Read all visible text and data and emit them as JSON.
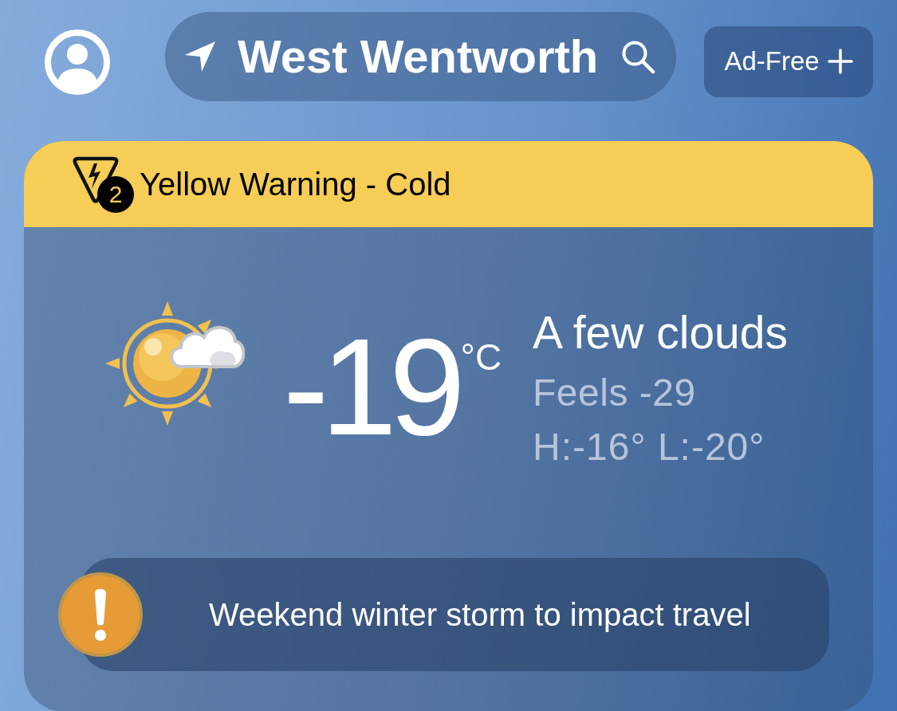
{
  "header": {
    "location": "West Wentworth",
    "ad_free_label": "Ad-Free"
  },
  "warning_banner": {
    "title": "Yellow Warning - Cold",
    "count": "2"
  },
  "current": {
    "temperature": "-19",
    "unit": "°C",
    "condition": "A few clouds",
    "feels_like": "Feels -29",
    "high_low": "H:-16° L:-20°"
  },
  "news": {
    "headline": "Weekend winter storm to impact travel"
  }
}
